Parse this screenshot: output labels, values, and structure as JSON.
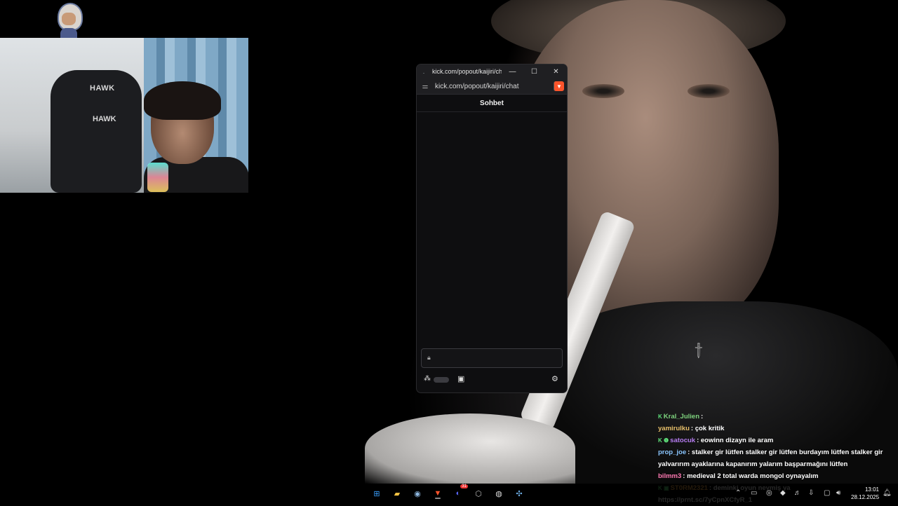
{
  "popout": {
    "title": "kick.com/popout/kaijiri/cha...",
    "url": "kick.com/popout/kaijiri/chat",
    "chat_header": "Sohbet",
    "minimize": "—",
    "maximize": "☐",
    "close": "✕"
  },
  "webcam": {
    "chair_logo": "HAWK",
    "chair_logo2": "HAWK"
  },
  "chat_overlay": {
    "messages": [
      {
        "badges": "K",
        "user": "Kral_Julien",
        "user_color": "#7fd47f",
        "text": ":"
      },
      {
        "badges": "",
        "user": "yamirulku",
        "user_color": "#e8c06a",
        "text": ": çok kritik"
      },
      {
        "badges": "K ❶",
        "user": "satocuk",
        "user_color": "#b57cf0",
        "text": ": eowinn dizayn ile aram"
      },
      {
        "badges": "",
        "user": "prop_joe",
        "user_color": "#8ac6ff",
        "text": ": stalker gir lütfen stalker gir lütfen burdayım lütfen stalker gir yalvarırım ayaklarına kapanırım yalarım başparmağını lütfen"
      },
      {
        "badges": "",
        "user": "bilmm3",
        "user_color": "#ff7ab3",
        "text": ": medieval 2 total warda mongol oynayalım"
      },
      {
        "badges": "K ▣",
        "user": "ST0RM2321",
        "user_color": "#f0a848",
        "text": ": deminki oyun neymiş ya"
      }
    ],
    "bottom_link": "https://prnt.sc/7yCpnXCfyR_1"
  },
  "taskbar": {
    "apps": [
      {
        "name": "windows-start-icon",
        "glyph": "⊞",
        "color": "#3aa0ff"
      },
      {
        "name": "file-explorer-icon",
        "glyph": "▰",
        "color": "#f3c343"
      },
      {
        "name": "steam-icon",
        "glyph": "◉",
        "color": "#8fb8e0"
      },
      {
        "name": "brave-browser-icon",
        "glyph": "▼",
        "color": "#fb542b"
      },
      {
        "name": "discord-icon",
        "glyph": "◐",
        "color": "#5865f2"
      },
      {
        "name": "obs-icon",
        "glyph": "⬡",
        "color": "#bbbbbb"
      },
      {
        "name": "obs-studio-icon",
        "glyph": "◍",
        "color": "#dddddd"
      },
      {
        "name": "app-icon",
        "glyph": "✣",
        "color": "#6fb0e8"
      }
    ],
    "discord_badge": "31",
    "time": "13:01",
    "date": "28.12.2025"
  }
}
